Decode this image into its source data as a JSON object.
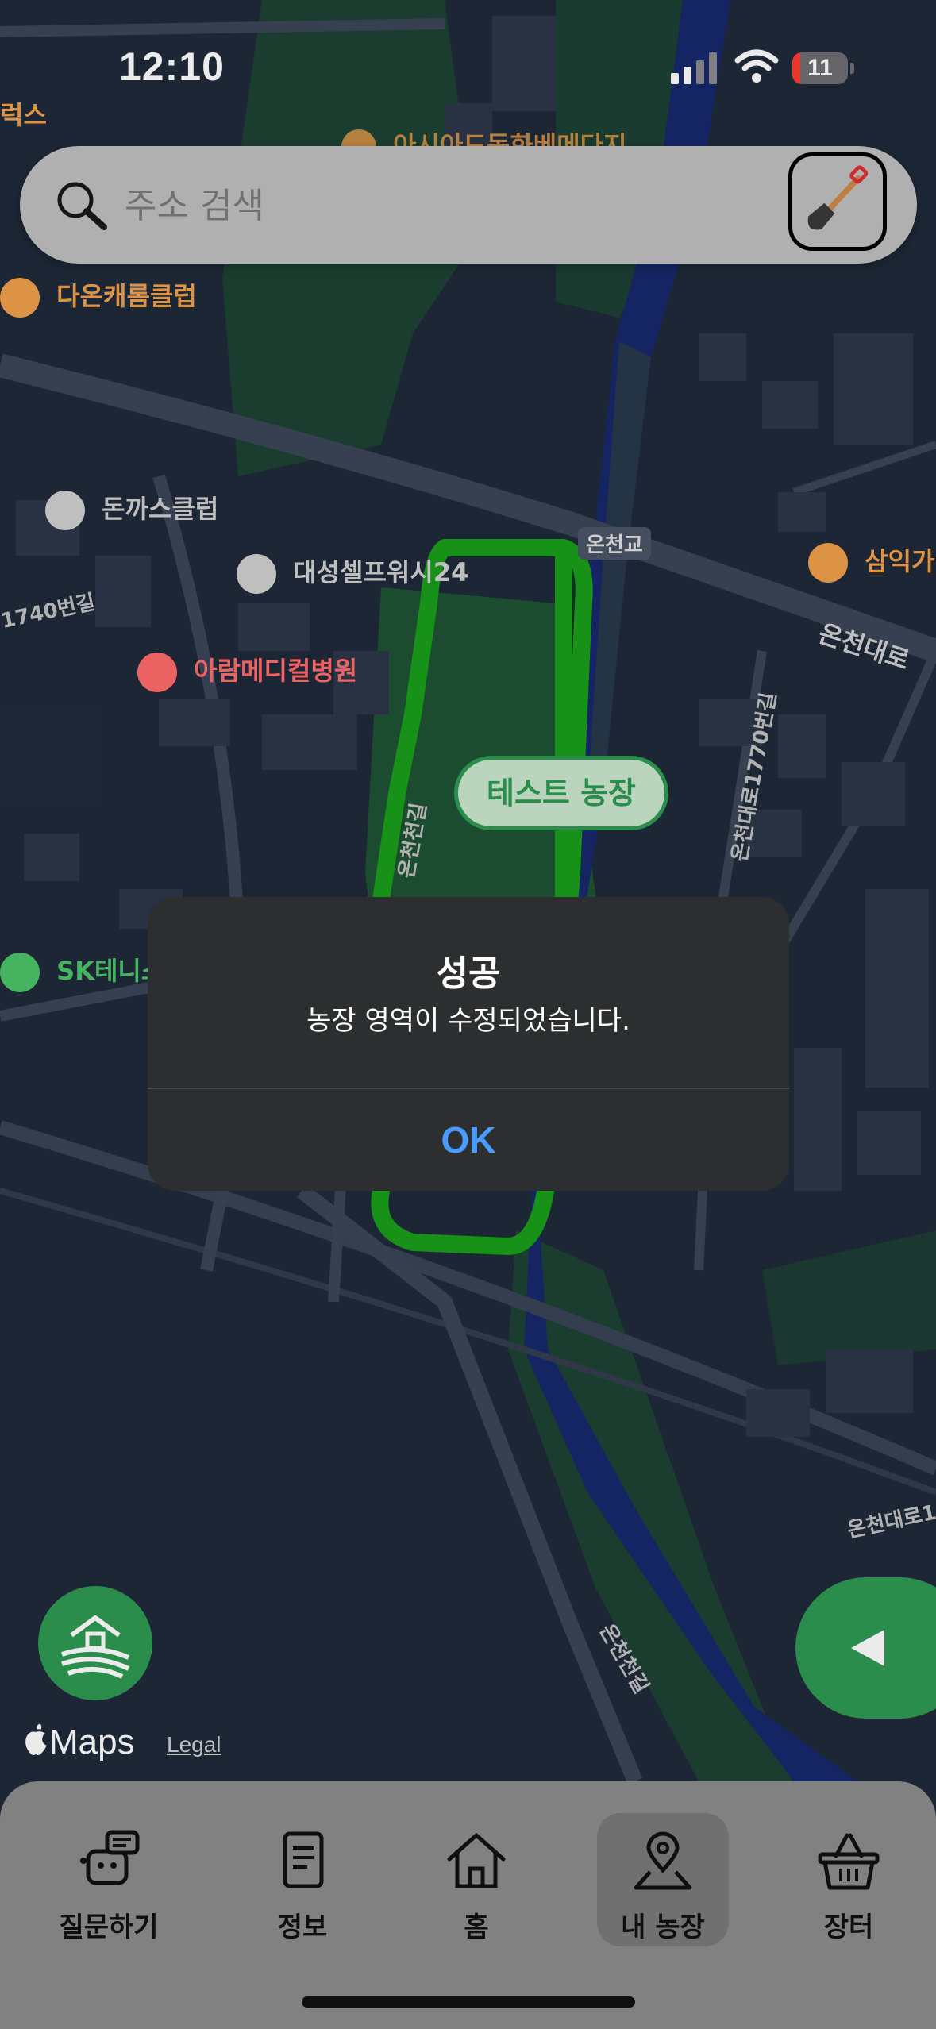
{
  "status_bar": {
    "time": "12:10",
    "battery": "11"
  },
  "search": {
    "placeholder": "주소 검색",
    "shovel_icon": "shovel-icon"
  },
  "map": {
    "road_labels": [
      "온천교",
      "온천대로",
      "온천대로1770번길",
      "온천천길",
      "1740번길",
      "온천대로1"
    ],
    "pois": [
      {
        "name": "다온캐롬클럽",
        "color": "#f0a04b"
      },
      {
        "name": "돈까스클럽",
        "color": "#d0d0d0"
      },
      {
        "name": "대성셀프워시24",
        "color": "#d0d0d0"
      },
      {
        "name": "아람메디컬병원",
        "color": "#ff6b6b"
      },
      {
        "name": "SK테니스",
        "color": "#4cc36a"
      },
      {
        "name": "삼익가",
        "color": "#f0a04b"
      },
      {
        "name": "럭스",
        "color": "#f0a04b"
      },
      {
        "name": "아시아드동화베메다지",
        "color": "#f0a04b"
      }
    ],
    "farm_label": "테스트 농장",
    "colors": {
      "farm_border": "#1a9e1a",
      "river": "#17286b",
      "park": "#1d4a32"
    }
  },
  "alert": {
    "title": "성공",
    "message": "농장 영역이 수정되었습니다.",
    "ok_label": "OK"
  },
  "attribution": {
    "maps": "Maps",
    "legal": "Legal"
  },
  "tabbar": {
    "items": [
      {
        "label": "질문하기",
        "icon": "robot-chat-icon"
      },
      {
        "label": "정보",
        "icon": "book-icon"
      },
      {
        "label": "홈",
        "icon": "home-icon"
      },
      {
        "label": "내 농장",
        "icon": "map-pin-icon",
        "active": true
      },
      {
        "label": "장터",
        "icon": "basket-icon"
      }
    ]
  },
  "accent_color": "#2e9a53"
}
